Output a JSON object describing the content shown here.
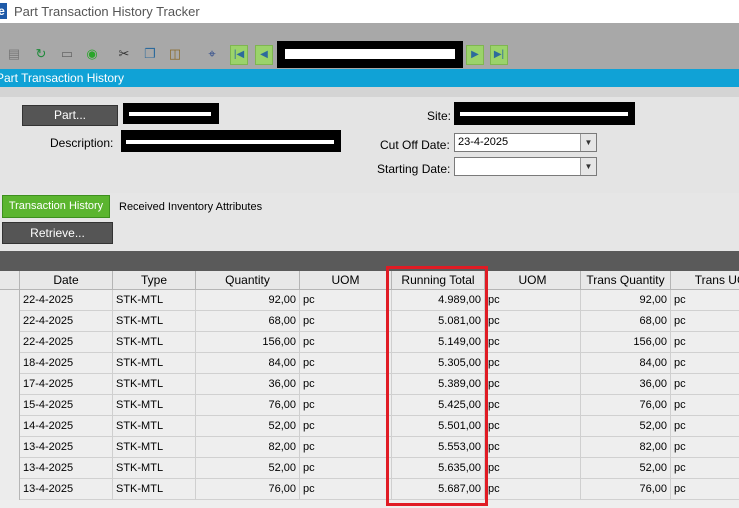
{
  "window": {
    "title": "Part Transaction History Tracker",
    "logo_glyph": "e"
  },
  "toolbar": {
    "icons": [
      "paper-icon",
      "refresh-icon",
      "eraser-icon",
      "go-icon",
      "cut-icon",
      "copy-icon",
      "paste-icon",
      "binoculars-icon",
      "first-record-icon",
      "previous-record-icon",
      "next-record-icon",
      "last-record-icon"
    ],
    "glyphs": {
      "cut": "✂",
      "binoculars": "⌖",
      "first": "|◀",
      "prev": "◀",
      "next": "▶",
      "last": "▶|"
    }
  },
  "section": {
    "title": "Part Transaction History"
  },
  "form": {
    "part_button": "Part...",
    "description_label": "Description:",
    "site_label": "Site:",
    "cutoff_label": "Cut Off Date:",
    "cutoff_value": "23-4-2025",
    "starting_label": "Starting Date:",
    "starting_value": "",
    "dropdown_glyph": "▼"
  },
  "tabs": [
    {
      "label": "Transaction History",
      "active": true
    },
    {
      "label": "Received Inventory Attributes",
      "active": false
    }
  ],
  "retrieve_button": "Retrieve...",
  "grid": {
    "columns": [
      "Date",
      "Type",
      "Quantity",
      "UOM",
      "Running Total",
      "UOM",
      "Trans Quantity",
      "Trans UOM"
    ],
    "rows": [
      [
        "22-4-2025",
        "STK-MTL",
        "92,00",
        "pc",
        "4.989,00",
        "pc",
        "92,00",
        "pc"
      ],
      [
        "22-4-2025",
        "STK-MTL",
        "68,00",
        "pc",
        "5.081,00",
        "pc",
        "68,00",
        "pc"
      ],
      [
        "22-4-2025",
        "STK-MTL",
        "156,00",
        "pc",
        "5.149,00",
        "pc",
        "156,00",
        "pc"
      ],
      [
        "18-4-2025",
        "STK-MTL",
        "84,00",
        "pc",
        "5.305,00",
        "pc",
        "84,00",
        "pc"
      ],
      [
        "17-4-2025",
        "STK-MTL",
        "36,00",
        "pc",
        "5.389,00",
        "pc",
        "36,00",
        "pc"
      ],
      [
        "15-4-2025",
        "STK-MTL",
        "76,00",
        "pc",
        "5.425,00",
        "pc",
        "76,00",
        "pc"
      ],
      [
        "14-4-2025",
        "STK-MTL",
        "52,00",
        "pc",
        "5.501,00",
        "pc",
        "52,00",
        "pc"
      ],
      [
        "13-4-2025",
        "STK-MTL",
        "82,00",
        "pc",
        "5.553,00",
        "pc",
        "82,00",
        "pc"
      ],
      [
        "13-4-2025",
        "STK-MTL",
        "52,00",
        "pc",
        "5.635,00",
        "pc",
        "52,00",
        "pc"
      ],
      [
        "13-4-2025",
        "STK-MTL",
        "76,00",
        "pc",
        "5.687,00",
        "pc",
        "76,00",
        "pc"
      ]
    ]
  },
  "colors": {
    "accent": "#10a2d6",
    "tab_active": "#5bb52f",
    "highlight": "#e01b24"
  }
}
